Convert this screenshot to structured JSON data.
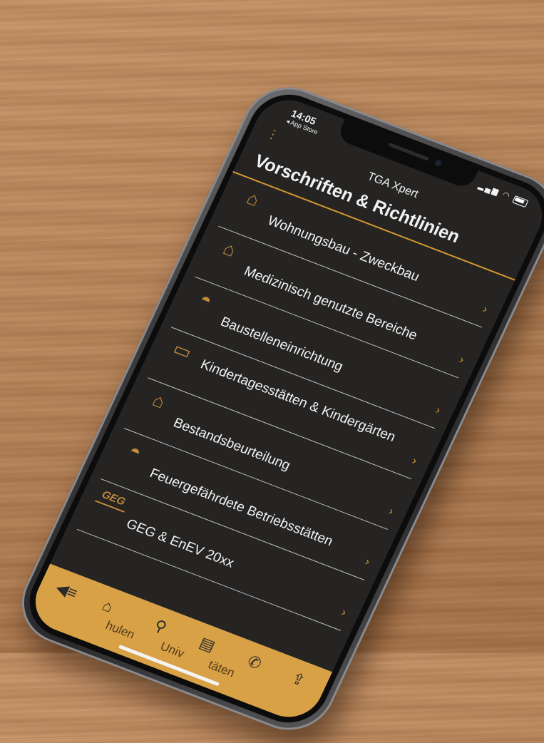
{
  "status": {
    "time": "14:05",
    "back_link": "◂ App Store",
    "signal": "▂▄▆",
    "wifi": "◠"
  },
  "header": {
    "menu_icon": "kebab-icon",
    "app_title": "TGA Xpert",
    "page_title": "Vorschriften & Richtlinien"
  },
  "list": [
    {
      "label": "Wohnungsbau - Zweckbau",
      "icon": "house-icon",
      "glyph": "⌂"
    },
    {
      "label": "Medizinisch genutzte Bereiche",
      "icon": "hospital-house-icon",
      "glyph": "⌂"
    },
    {
      "label": "Baustelleneinrichtung",
      "icon": "hard-hat-icon",
      "glyph": "◓"
    },
    {
      "label": "Kindertagesstätten & Kindergärten",
      "icon": "kindergarten-icon",
      "glyph": "▭"
    },
    {
      "label": "Bestandsbeurteilung",
      "icon": "building-icon",
      "glyph": "⌂"
    },
    {
      "label": "Feuergefährdete Betriebsstätten",
      "icon": "factory-icon",
      "glyph": "◓"
    },
    {
      "label": "GEG & EnEV 20xx",
      "icon": "geg-logo-icon",
      "glyph": "GEG"
    }
  ],
  "chevron": "›",
  "tabbar": {
    "labels": [
      "hulen",
      "Univ",
      "täten"
    ],
    "icons": [
      "back-list-icon",
      "home-icon",
      "search-icon",
      "document-icon",
      "phone-icon",
      "share-icon"
    ],
    "accent": "#d9a146"
  },
  "colors": {
    "accent": "#d4982e",
    "screen_bg": "#252423"
  }
}
